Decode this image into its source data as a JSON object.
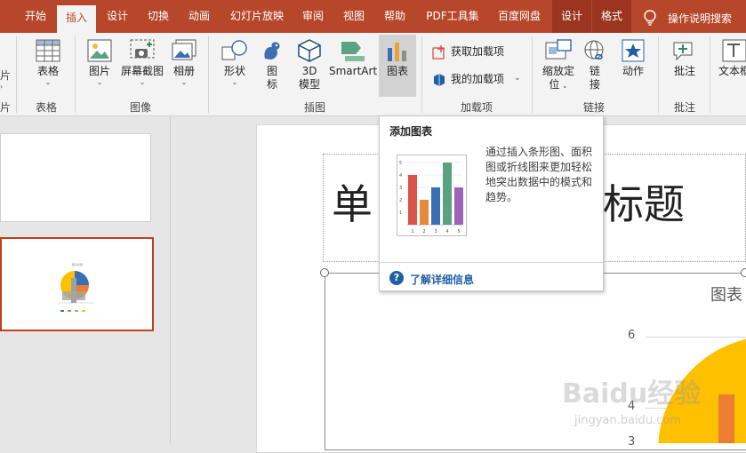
{
  "tabs": [
    {
      "label": "开始"
    },
    {
      "label": "插入"
    },
    {
      "label": "设计"
    },
    {
      "label": "切换"
    },
    {
      "label": "动画"
    },
    {
      "label": "幻灯片放映"
    },
    {
      "label": "审阅"
    },
    {
      "label": "视图"
    },
    {
      "label": "帮助"
    },
    {
      "label": "PDF工具集"
    },
    {
      "label": "百度网盘"
    },
    {
      "label": "设计"
    },
    {
      "label": "格式"
    }
  ],
  "tell_me": "操作说明搜索",
  "ribbon": {
    "table_label": "表格",
    "picture_label": "图片",
    "screenshot_label": "屏幕截图",
    "album_label": "相册",
    "shapes_label": "形状",
    "icons_label_1": "图",
    "icons_label_2": "标",
    "model3d_label_1": "3D",
    "model3d_label_2": "模型",
    "smartart_label": "SmartArt",
    "chart_label": "图表",
    "get_addins_label": "获取加载项",
    "my_addins_label": "我的加载项",
    "zoom_label_1": "缩放定",
    "zoom_label_2": "位",
    "link_label_1": "链",
    "link_label_2": "接",
    "action_label": "动作",
    "comment_label": "批注",
    "textbox_label": "文本框",
    "group_tables": "表格",
    "group_images": "图像",
    "group_illustrations": "插图",
    "group_addins": "加载项",
    "group_links": "链接",
    "group_comments": "批注"
  },
  "tooltip": {
    "title": "添加图表",
    "description": "通过插入条形图、面积图或折线图来更加轻松地突出数据中的模式和趋势。",
    "link": "了解详细信息",
    "mini_chart_values": [
      4,
      2,
      3,
      5,
      3
    ],
    "mini_chart_xticks": [
      "1",
      "2",
      "3",
      "4",
      "5"
    ],
    "mini_chart_yticks": [
      "5",
      "4",
      "3",
      "2",
      "1"
    ],
    "bar_colors": [
      "#d9534a",
      "#e8883a",
      "#3b6fb4",
      "#5aa382",
      "#9c63b8"
    ]
  },
  "slide": {
    "title_left": "单",
    "title_right": "标题",
    "chart_title_partial": "图表",
    "y_ticks": [
      "6",
      "4",
      "3"
    ]
  },
  "thumbnail2": {
    "title": "图表标题"
  },
  "watermark": {
    "main": "Baidu经验",
    "sub": "jingyan.baidu.com"
  },
  "colors": {
    "accent": "#b7472a",
    "pie_yellow": "#ffc000",
    "pie_orange": "#ed7d31",
    "selection": "#c43e1c",
    "link_blue": "#1f5fa8"
  }
}
